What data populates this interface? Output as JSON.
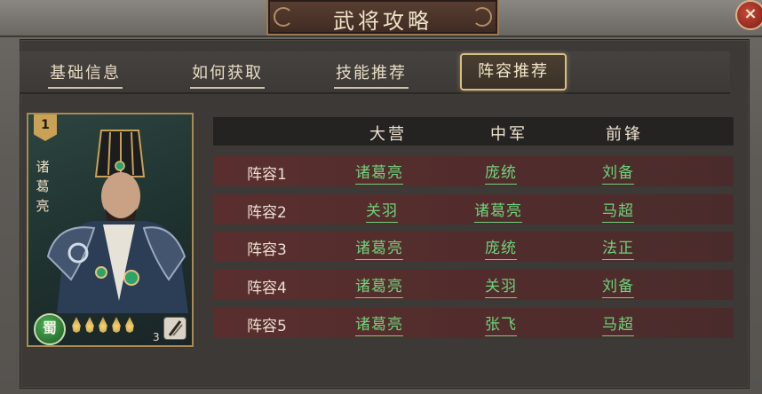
{
  "window": {
    "title": "武将攻略",
    "close_symbol": "×"
  },
  "tabs": [
    {
      "label": "基础信息",
      "active": false
    },
    {
      "label": "如何获取",
      "active": false
    },
    {
      "label": "技能推荐",
      "active": false
    },
    {
      "label": "阵容推荐",
      "active": true
    }
  ],
  "hero_card": {
    "level": "1",
    "name_chars": [
      "诸",
      "葛",
      "亮"
    ],
    "faction": "蜀",
    "star_count": 5,
    "count": "3",
    "icons": {
      "faction": "shu-faction-icon",
      "weapon": "weapon-icon"
    }
  },
  "table": {
    "columns": [
      "大营",
      "中军",
      "前锋"
    ],
    "rows": [
      {
        "label": "阵容1",
        "values": [
          "诸葛亮",
          "庞统",
          "刘备"
        ]
      },
      {
        "label": "阵容2",
        "values": [
          "关羽",
          "诸葛亮",
          "马超"
        ]
      },
      {
        "label": "阵容3",
        "values": [
          "诸葛亮",
          "庞统",
          "法正"
        ]
      },
      {
        "label": "阵容4",
        "values": [
          "诸葛亮",
          "关羽",
          "刘备"
        ]
      },
      {
        "label": "阵容5",
        "values": [
          "诸葛亮",
          "张飞",
          "马超"
        ]
      }
    ]
  },
  "colors": {
    "accent_gold": "#d9be84",
    "link_green": "#6fd27b",
    "row_red": "#5a2e2e",
    "faction_green": "#2f8a3a"
  }
}
